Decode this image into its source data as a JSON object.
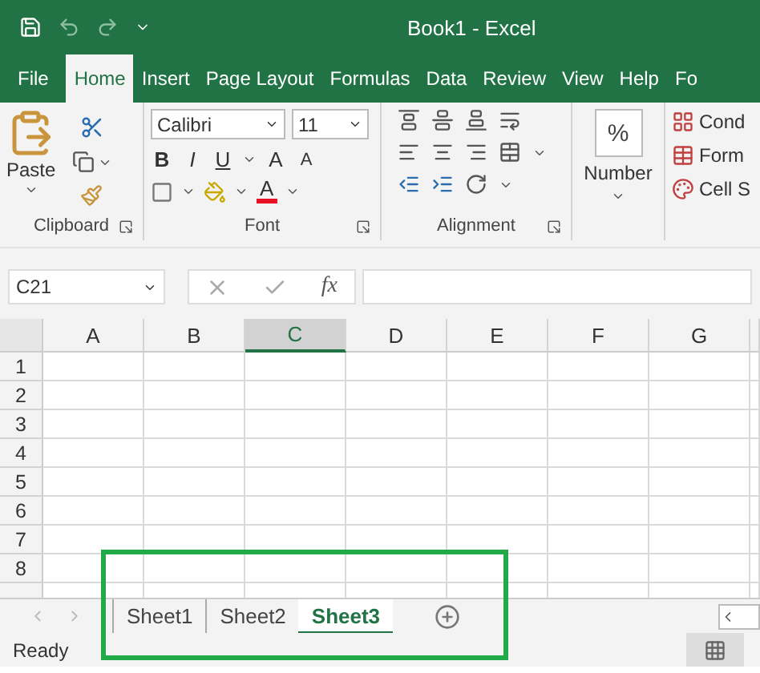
{
  "window": {
    "title": "Book1  -  Excel"
  },
  "tabs": [
    {
      "label": "File",
      "selected": false
    },
    {
      "label": "Home",
      "selected": true
    },
    {
      "label": "Insert",
      "selected": false
    },
    {
      "label": "Page Layout",
      "selected": false
    },
    {
      "label": "Formulas",
      "selected": false
    },
    {
      "label": "Data",
      "selected": false
    },
    {
      "label": "Review",
      "selected": false
    },
    {
      "label": "View",
      "selected": false
    },
    {
      "label": "Help",
      "selected": false
    },
    {
      "label": "Fo",
      "selected": false
    }
  ],
  "ribbon": {
    "clipboard": {
      "paste": "Paste",
      "label": "Clipboard"
    },
    "font": {
      "name": "Calibri",
      "size": "11",
      "bold": "B",
      "italic": "I",
      "underline": "U",
      "grow": "A",
      "shrink": "A",
      "font_color": "A",
      "label": "Font"
    },
    "alignment": {
      "label": "Alignment"
    },
    "number": {
      "symbol": "%",
      "label": "Number"
    },
    "styles": [
      "Cond",
      "Form",
      "Cell S"
    ]
  },
  "formula_bar": {
    "name_box": "C21",
    "fx": "fx"
  },
  "sheet": {
    "columns": [
      {
        "label": "A",
        "selected": false
      },
      {
        "label": "B",
        "selected": false
      },
      {
        "label": "C",
        "selected": true
      },
      {
        "label": "D",
        "selected": false
      },
      {
        "label": "E",
        "selected": false
      },
      {
        "label": "F",
        "selected": false
      },
      {
        "label": "G",
        "selected": false
      }
    ],
    "rows": [
      "1",
      "2",
      "3",
      "4",
      "5",
      "6",
      "7",
      "8"
    ]
  },
  "sheet_tabs": [
    {
      "label": "Sheet1",
      "selected": false
    },
    {
      "label": "Sheet2",
      "selected": false
    },
    {
      "label": "Sheet3",
      "selected": true
    }
  ],
  "status_bar": {
    "text": "Ready"
  }
}
